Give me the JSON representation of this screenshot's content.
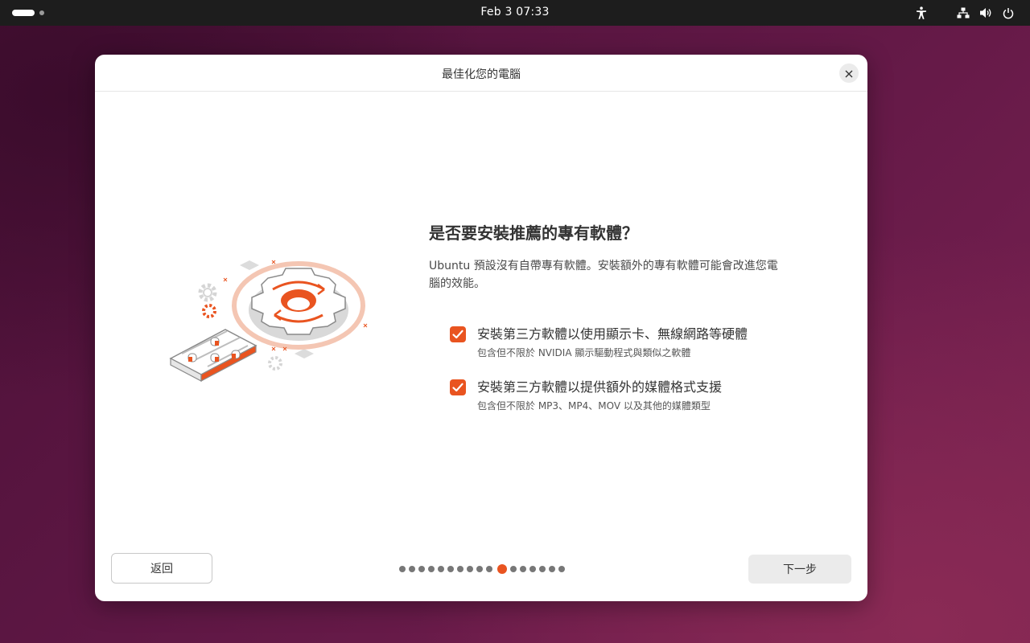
{
  "topbar": {
    "clock": "Feb 3  07:33",
    "icons": [
      "activities-indicator",
      "accessibility-icon",
      "network-icon",
      "volume-icon",
      "power-icon"
    ]
  },
  "dialog": {
    "title": "最佳化您的電腦",
    "heading": "是否要安裝推薦的專有軟體？",
    "description": "Ubuntu 預設沒有自帶專有軟體。安裝額外的專有軟體可能會改進您電腦的效能。",
    "options": [
      {
        "label": "安裝第三方軟體以使用顯示卡、無線網路等硬體",
        "sublabel": "包含但不限於 NVIDIA 顯示驅動程式與類似之軟體",
        "checked": true
      },
      {
        "label": "安裝第三方軟體以提供額外的媒體格式支援",
        "sublabel": "包含但不限於 MP3、MP4、MOV 以及其他的媒體類型",
        "checked": true
      }
    ],
    "back_label": "返回",
    "next_label": "下一步",
    "pager": {
      "total": 17,
      "current": 11
    }
  },
  "colors": {
    "accent": "#e95420",
    "topbar": "#1d1d1d",
    "dialog_bg": "#ffffff"
  }
}
